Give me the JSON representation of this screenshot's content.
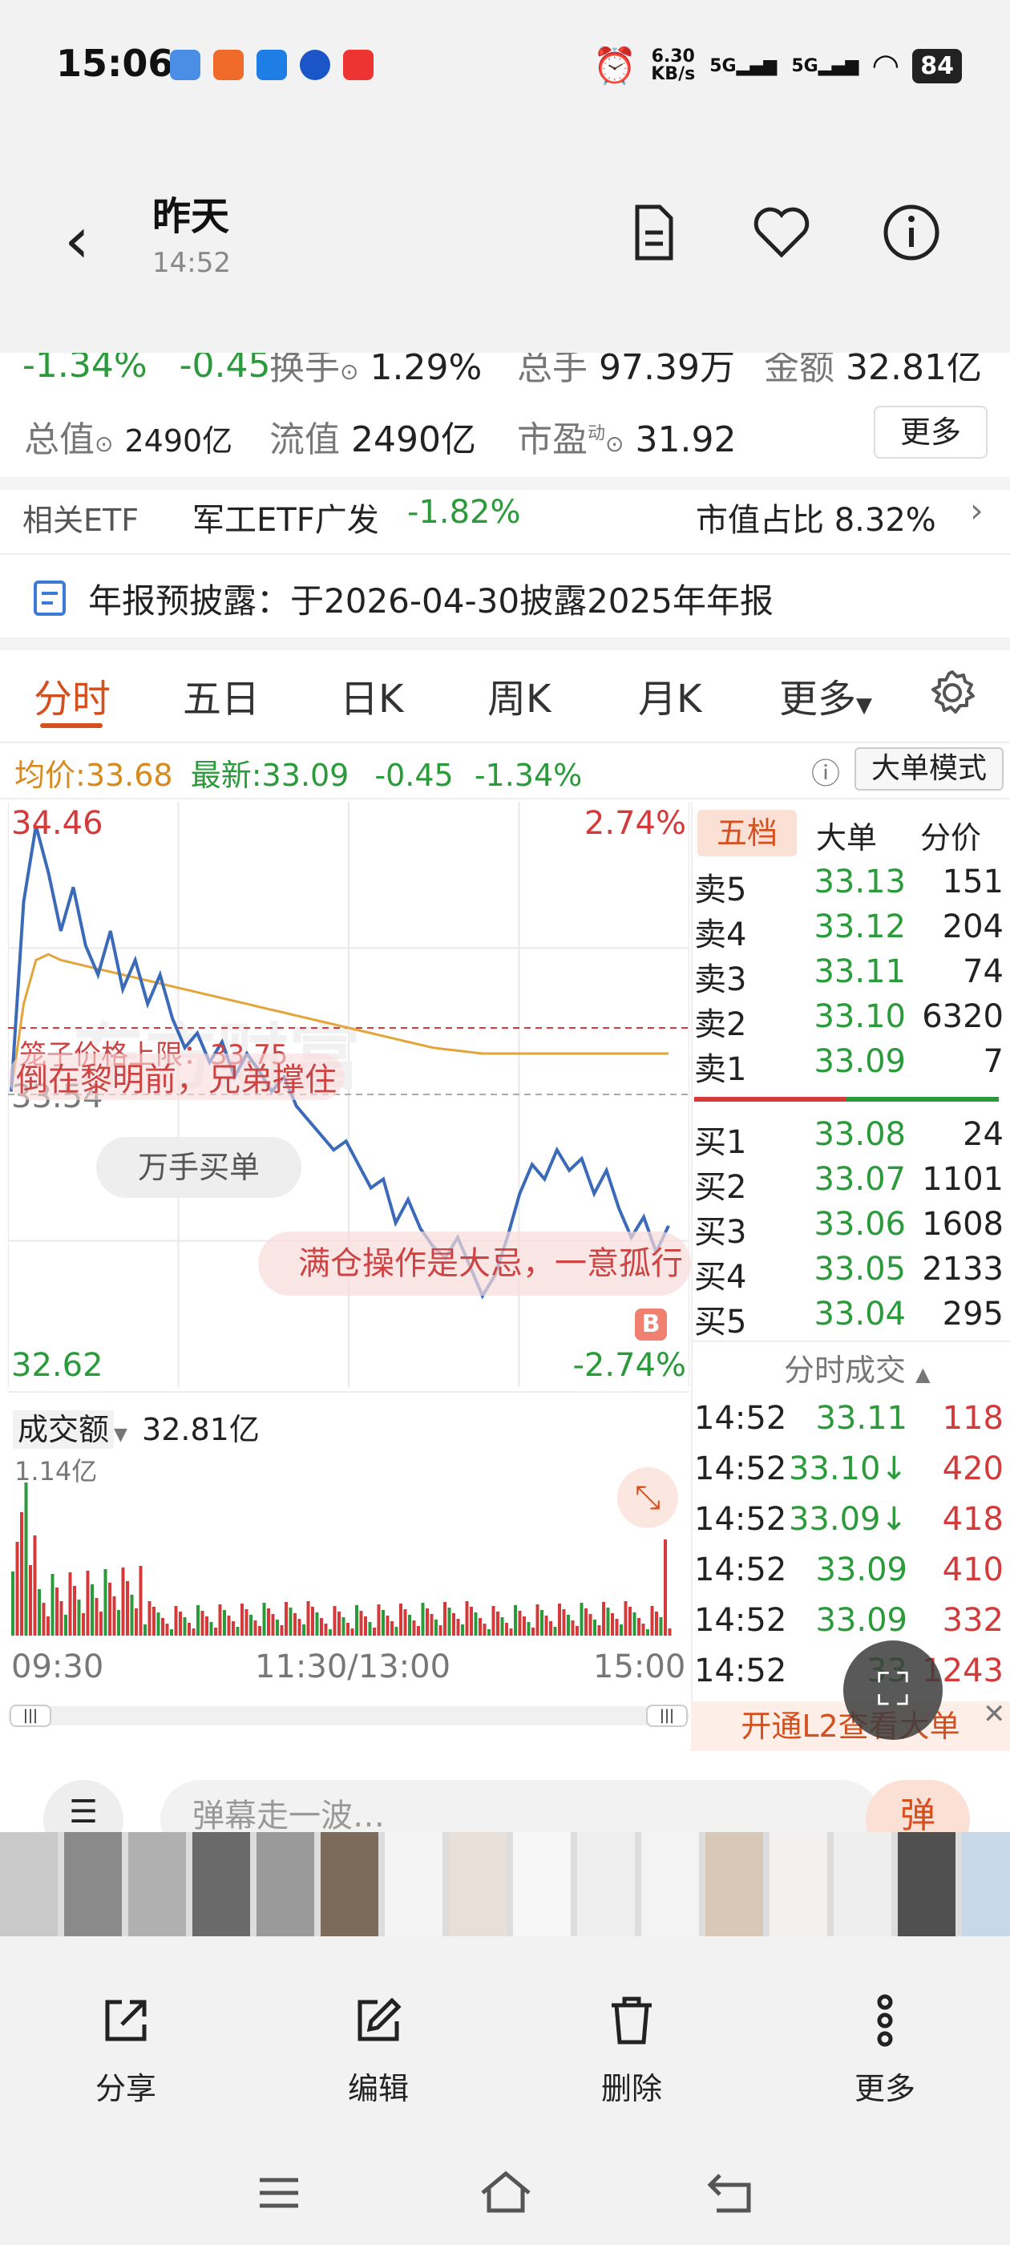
{
  "status_bar": {
    "time": "15:06",
    "net_speed_value": "6.30",
    "net_speed_unit": "KB/s",
    "sim1": "5G",
    "sim2": "5G",
    "battery": "84"
  },
  "header": {
    "title": "昨天",
    "subtitle": "14:52"
  },
  "quote": {
    "change_pct": "-1.34%",
    "change_amt": "-0.45",
    "turnover_label": "换手",
    "turnover_value": "1.29%",
    "volume_label": "总手",
    "volume_value": "97.39万",
    "amount_label": "金额",
    "amount_value": "32.81亿",
    "total_mv_label": "总值",
    "total_mv_value": "2490亿",
    "float_mv_label": "流值",
    "float_mv_value": "2490亿",
    "pe_label": "市盈",
    "pe_sup": "动",
    "pe_value": "31.92",
    "more_button": "更多"
  },
  "etf": {
    "label": "相关ETF",
    "name": "军工ETF广发",
    "change": "-1.82%",
    "weight_label": "市值占比",
    "weight_value": "8.32%"
  },
  "notice": {
    "text": "年报预披露：于2026-04-30披露2025年年报"
  },
  "tabs": [
    "分时",
    "五日",
    "日K",
    "周K",
    "月K",
    "更多"
  ],
  "info_line": {
    "avg_label": "均价:",
    "avg_value": "33.68",
    "latest_label": "最新:",
    "latest_value": "33.09",
    "chg": "-0.45",
    "pct": "-1.34%",
    "mode_button": "大单模式"
  },
  "chart_labels": {
    "high": "34.46",
    "high_pct": "2.74%",
    "mid": "33.54",
    "low": "32.62",
    "low_pct": "-2.74%",
    "limit_text": "笼子价格上限：33.75",
    "bullet1": "倒在黎明前，兄弟撑住",
    "bullet2": "满仓操作是大忌，一意孤行",
    "big_order_chip": "万手买单",
    "watermark": "东方财富",
    "b_marker": "B"
  },
  "chart_data": {
    "type": "line",
    "title": "",
    "ylim": [
      32.62,
      34.46
    ],
    "series": [
      {
        "values": [
          33.55,
          34.2,
          34.46,
          34.3,
          34.1,
          34.25,
          34.05,
          33.95,
          34.1,
          33.9,
          34.0,
          33.85,
          33.95,
          33.8,
          33.7,
          33.75,
          33.65,
          33.72,
          33.6,
          33.68,
          33.62,
          33.55,
          33.6,
          33.5,
          33.45,
          33.4,
          33.35,
          33.38,
          33.3,
          33.22,
          33.25,
          33.1,
          33.18,
          33.08,
          33.02,
          32.98,
          33.05,
          32.95,
          32.85,
          32.92,
          33.05,
          33.2,
          33.3,
          33.25,
          33.35,
          33.28,
          33.32,
          33.2,
          33.28,
          33.15,
          33.05,
          33.12,
          33.0,
          33.09
        ]
      },
      {
        "values": [
          33.55,
          33.85,
          34.0,
          34.02,
          34.0,
          33.99,
          33.98,
          33.97,
          33.96,
          33.95,
          33.94,
          33.93,
          33.92,
          33.91,
          33.9,
          33.89,
          33.88,
          33.87,
          33.86,
          33.85,
          33.84,
          33.83,
          33.82,
          33.81,
          33.8,
          33.79,
          33.78,
          33.77,
          33.76,
          33.75,
          33.74,
          33.73,
          33.72,
          33.71,
          33.7,
          33.695,
          33.69,
          33.685,
          33.68,
          33.68,
          33.68,
          33.68,
          33.68,
          33.68,
          33.68,
          33.68,
          33.68,
          33.68,
          33.68,
          33.68,
          33.68,
          33.68,
          33.68,
          33.68
        ]
      }
    ]
  },
  "volume": {
    "label": "成交额",
    "value": "32.81亿",
    "axis_max": "1.14亿",
    "t_start": "09:30",
    "t_mid": "11:30/13:00",
    "t_end": "15:00"
  },
  "orderbook": {
    "tabs": [
      "五档",
      "大单",
      "分价"
    ],
    "asks": [
      {
        "label": "卖5",
        "price": "33.13",
        "vol": "151"
      },
      {
        "label": "卖4",
        "price": "33.12",
        "vol": "204"
      },
      {
        "label": "卖3",
        "price": "33.11",
        "vol": "74"
      },
      {
        "label": "卖2",
        "price": "33.10",
        "vol": "6320"
      },
      {
        "label": "卖1",
        "price": "33.09",
        "vol": "7"
      }
    ],
    "bids": [
      {
        "label": "买1",
        "price": "33.08",
        "vol": "24"
      },
      {
        "label": "买2",
        "price": "33.07",
        "vol": "1101"
      },
      {
        "label": "买3",
        "price": "33.06",
        "vol": "1608"
      },
      {
        "label": "买4",
        "price": "33.05",
        "vol": "2133"
      },
      {
        "label": "买5",
        "price": "33.04",
        "vol": "295"
      }
    ],
    "ticks_title": "分时成交",
    "ticks": [
      {
        "time": "14:52",
        "price": "33.11",
        "vol": "118"
      },
      {
        "time": "14:52",
        "price": "33.10↓",
        "vol": "420"
      },
      {
        "time": "14:52",
        "price": "33.09↓",
        "vol": "418"
      },
      {
        "time": "14:52",
        "price": "33.09",
        "vol": "410"
      },
      {
        "time": "14:52",
        "price": "33.09",
        "vol": "332"
      },
      {
        "time": "14:52",
        "price": "33",
        "vol": "1243"
      }
    ],
    "l2_text": "开通L2查看大单"
  },
  "comment_bar": {
    "placeholder": "弹幕走一波…",
    "danmu_button": "弹"
  },
  "actions": [
    "分享",
    "编辑",
    "删除",
    "更多"
  ]
}
